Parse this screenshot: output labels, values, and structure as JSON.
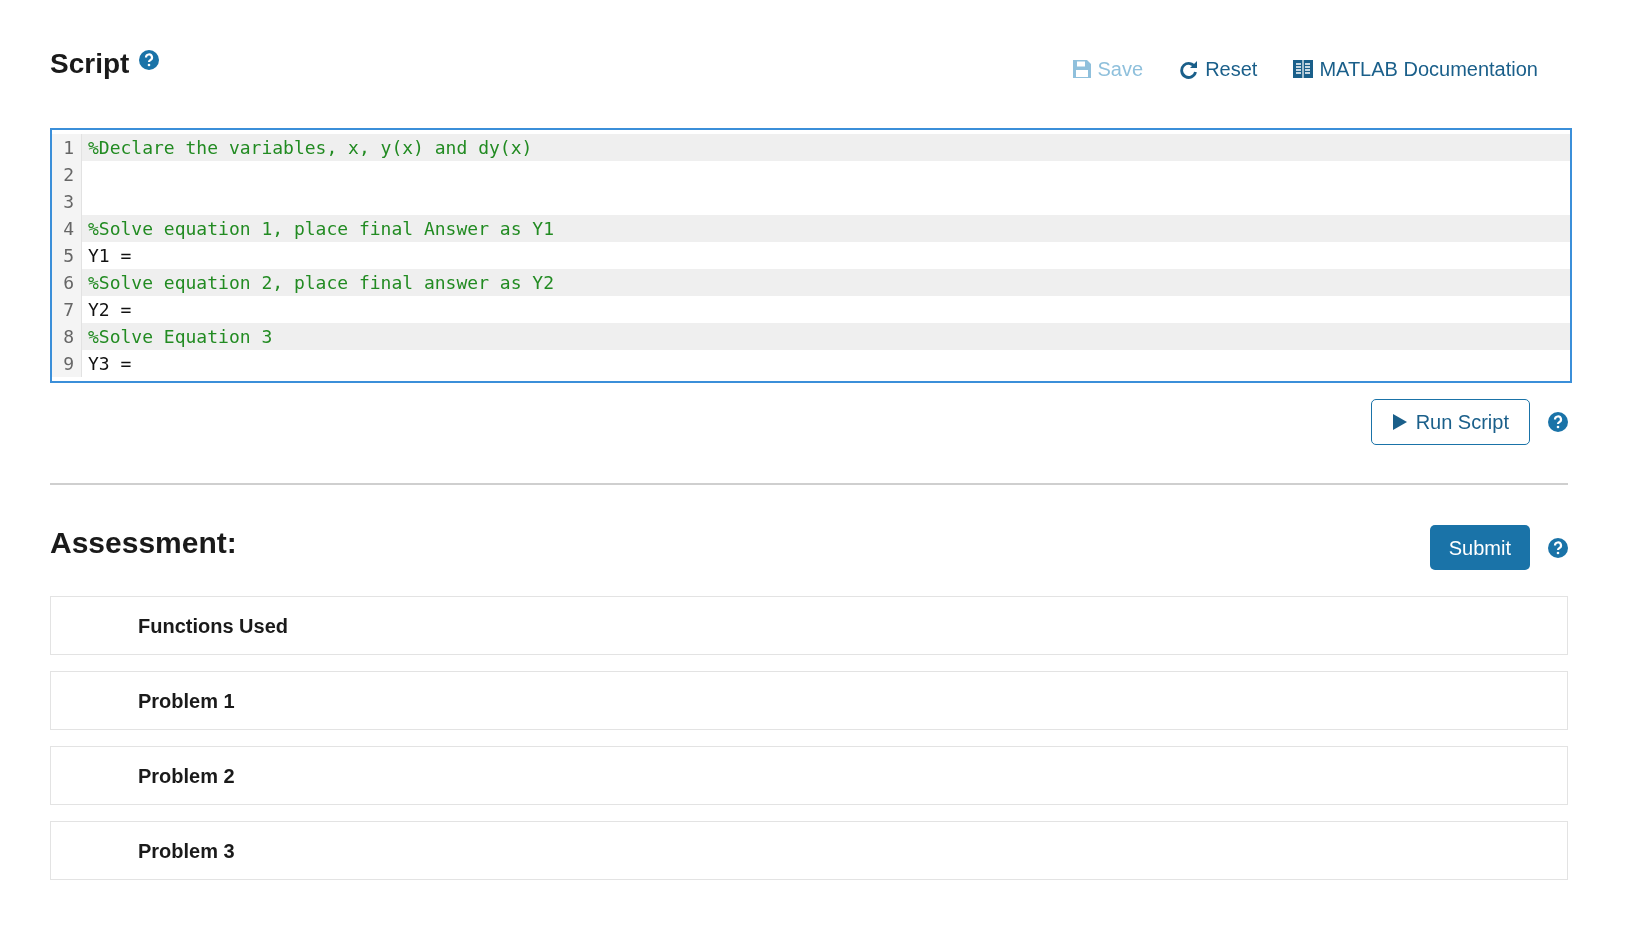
{
  "script_header": {
    "title": "Script",
    "actions": [
      {
        "kind": "save",
        "label": "Save",
        "disabled": true
      },
      {
        "kind": "reset",
        "label": "Reset",
        "disabled": false
      },
      {
        "kind": "docs",
        "label": "MATLAB Documentation",
        "disabled": false
      }
    ]
  },
  "editor": {
    "lines": [
      {
        "number": "1",
        "kind": "comment",
        "text": "%Declare the variables, x, y(x) and dy(x)"
      },
      {
        "number": "2",
        "kind": "code"
      },
      {
        "number": "3",
        "kind": "code"
      },
      {
        "number": "4",
        "kind": "comment",
        "text": "%Solve equation 1, place final Answer as Y1"
      },
      {
        "number": "5",
        "kind": "code",
        "text": "Y1 ="
      },
      {
        "number": "6",
        "kind": "comment",
        "text": "%Solve equation 2, place final answer as Y2"
      },
      {
        "number": "7",
        "kind": "code",
        "text": "Y2 ="
      },
      {
        "number": "8",
        "kind": "comment",
        "text": "%Solve Equation 3"
      },
      {
        "number": "9",
        "kind": "code",
        "text": "Y3 ="
      }
    ]
  },
  "run_button": {
    "label": "Run Script"
  },
  "assessment": {
    "title": "Assessment:",
    "submit_label": "Submit",
    "items": [
      "Functions Used",
      "Problem 1",
      "Problem 2",
      "Problem 3"
    ]
  }
}
